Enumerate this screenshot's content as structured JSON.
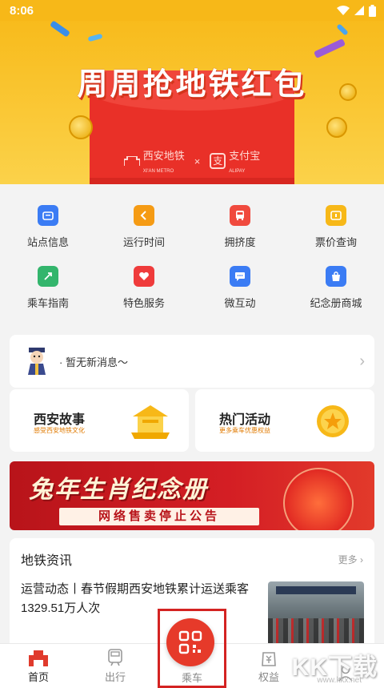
{
  "status_bar": {
    "time": "8:06"
  },
  "banner": {
    "title": "周周抢地铁红包",
    "logo_left": "西安地铁",
    "logo_left_sub": "XI'AN METRO",
    "separator": "×",
    "logo_right": "支付宝",
    "logo_right_sub": "ALIPAY"
  },
  "grid": {
    "items": [
      {
        "label": "站点信息",
        "icon": "station-info-icon",
        "color": "#3b7cf4"
      },
      {
        "label": "运行时间",
        "icon": "time-icon",
        "color": "#f59b14"
      },
      {
        "label": "拥挤度",
        "icon": "bus-icon",
        "color": "#f04a3e"
      },
      {
        "label": "票价查询",
        "icon": "ticket-icon",
        "color": "#f7b818"
      },
      {
        "label": "乘车指南",
        "icon": "guide-icon",
        "color": "#33b56c"
      },
      {
        "label": "特色服务",
        "icon": "heart-icon",
        "color": "#ef3b3b"
      },
      {
        "label": "微互动",
        "icon": "chat-icon",
        "color": "#3b7cf4"
      },
      {
        "label": "纪念册商城",
        "icon": "bag-icon",
        "color": "#3b7cf4"
      }
    ]
  },
  "notice": {
    "text": "· 暂无新消息～"
  },
  "promos": [
    {
      "title": "西安故事",
      "subtitle": "感受西安地铁文化"
    },
    {
      "title": "热门活动",
      "subtitle": "更多乘车优惠权益"
    }
  ],
  "ad": {
    "title": "兔年生肖纪念册",
    "subtitle": "网络售卖停止公告"
  },
  "news": {
    "heading": "地铁资讯",
    "more": "更多",
    "item_title": "运营动态丨春节假期西安地铁累计运送乘客1329.51万人次"
  },
  "tabs": [
    {
      "label": "首页",
      "icon": "home-icon",
      "active": true
    },
    {
      "label": "出行",
      "icon": "train-icon",
      "active": false
    },
    {
      "label": "乘车",
      "icon": "qr-icon",
      "active": false
    },
    {
      "label": "权益",
      "icon": "benefits-icon",
      "active": false
    },
    {
      "label": "",
      "icon": "profile-icon",
      "active": false
    }
  ],
  "watermark": {
    "brand": "KK下载",
    "url": "www.kkx.net"
  },
  "colors": {
    "accent": "#f7b818",
    "brand_red": "#e63a2a"
  }
}
